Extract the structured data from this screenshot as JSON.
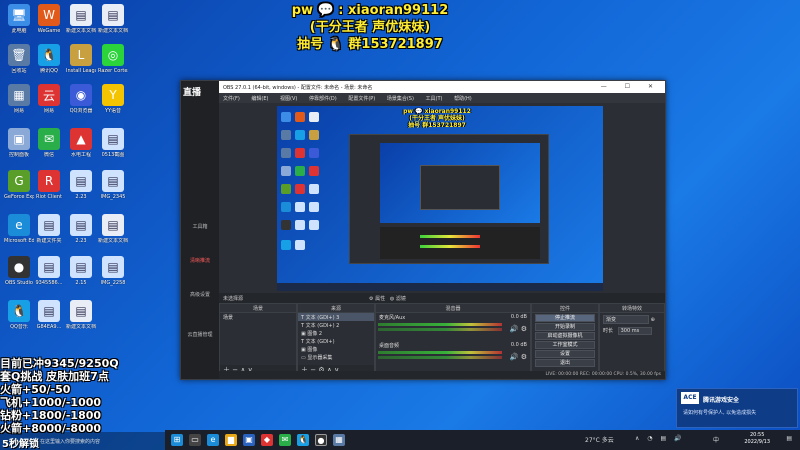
{
  "overlay_top": {
    "line1": "pw 💬 : xiaoran99112",
    "line2": "(干分王者 声优妹妹)",
    "line3": "抽号 🐧 群153721897"
  },
  "desktop_icons": [
    {
      "label": "此电脑",
      "color": "#3c8de6",
      "glyph": "🖥"
    },
    {
      "label": "回收站",
      "color": "#5a7aa6",
      "glyph": "🗑"
    },
    {
      "label": "网易",
      "color": "#d33",
      "glyph": "云"
    },
    {
      "label": "Microsoft Edge",
      "color": "#1a8cd8",
      "glyph": "e"
    },
    {
      "label": "OBS Studio",
      "color": "#333",
      "glyph": "●"
    },
    {
      "label": "GeForce Experience",
      "color": "#5a9e2a",
      "glyph": "G"
    },
    {
      "label": "微信",
      "color": "#2aae4a",
      "glyph": "✉"
    },
    {
      "label": "Riot Client",
      "color": "#d33",
      "glyph": "R"
    },
    {
      "label": "QQ音乐",
      "color": "#f3c316",
      "glyph": "♪"
    },
    {
      "label": "腾讯QQ",
      "color": "#18a0e6",
      "glyph": "🐧"
    },
    {
      "label": "Install League of...",
      "color": "#c8a040",
      "glyph": "L"
    },
    {
      "label": "Razer Cortex",
      "color": "#2ad43a",
      "glyph": "◎"
    },
    {
      "label": "YY语音",
      "color": "#f5c400",
      "glyph": "Y"
    },
    {
      "label": "WeGame",
      "color": "#e25a1a",
      "glyph": "W"
    },
    {
      "label": "2.23",
      "color": "#cfe3ff",
      "glyph": "▤"
    },
    {
      "label": "新建文本文档",
      "color": "#e9eef6",
      "glyph": "▤"
    }
  ],
  "obs": {
    "title": "OBS 27.0.1 (64-bit, windows) - 配置文件: 未命名 - 场景: 未命名",
    "rail_logo": "直播",
    "rail_items": [
      "工具箱",
      "清晰推流",
      "高级设置",
      "云直播管理"
    ],
    "menus": [
      "文件(F)",
      "编辑(E)",
      "视图(V)",
      "停靠部件(D)",
      "配置文件(P)",
      "场景集合(S)",
      "工具(T)",
      "帮助(H)"
    ],
    "preview_overlay": [
      "pw 💬 xiaoran99112",
      "(干分王者 声优妹妹)",
      "抽号 群153721897"
    ],
    "source_hint": "未选择源",
    "props_label": "属性",
    "filters_label": "滤镜",
    "scenes_header": "场景",
    "scenes": [
      "场景"
    ],
    "sources_header": "来源",
    "sources": [
      "文本 (GDI+) 3",
      "文本 (GDI+) 2",
      "图像 2",
      "文本 (GDI+)",
      "图像",
      "显示器采集"
    ],
    "mixer_header": "混音器",
    "mixer_channels": [
      {
        "name": "麦克风/Aux",
        "db": "0.0 dB"
      },
      {
        "name": "桌面音频",
        "db": "0.0 dB"
      }
    ],
    "transitions_header": "转场特效",
    "transition_value": "渐变",
    "duration_label": "时长",
    "duration_value": "300 ms",
    "controls_header": "控件",
    "controls": [
      "停止推流",
      "开始录制",
      "启动虚拟摄像机",
      "工作室模式",
      "设置",
      "退出"
    ],
    "status": "LIVE: 00:00:00   REC: 00:00:00   CPU: 0.5%, 30.00 fps"
  },
  "info_overlay": [
    "目前已冲9345/9250Q",
    "套Q挑战 皮肤加班7点",
    "火箭+50/-50",
    "飞机+1000/-1000",
    "钻粉+1800/-1800",
    "火箭+8000/-8000",
    "5秒解锁"
  ],
  "chat": {
    "prefix": "5",
    "placeholder": "在这里输入你要搜索的内容"
  },
  "notification": {
    "logo": "ACE",
    "title": "腾讯游戏安全",
    "body": "请如何有号保护人, 以免造成损失"
  },
  "taskbar": {
    "weather": "27°C 多云",
    "time": "20:55",
    "date": "2022/9/13",
    "lang": "中"
  }
}
